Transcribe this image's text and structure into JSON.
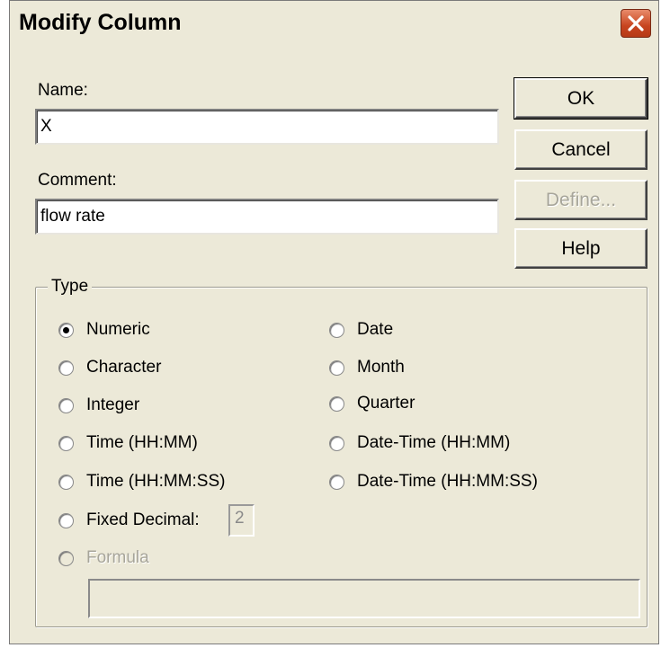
{
  "window": {
    "title": "Modify Column"
  },
  "fields": {
    "name_label": "Name:",
    "name_value": "X",
    "comment_label": "Comment:",
    "comment_value": "flow rate"
  },
  "buttons": {
    "ok": "OK",
    "cancel": "Cancel",
    "define": "Define...",
    "help": "Help"
  },
  "type_group": {
    "label": "Type",
    "selected": "Numeric",
    "left_options": [
      "Numeric",
      "Character",
      "Integer",
      "Time (HH:MM)",
      "Time (HH:MM:SS)",
      "Fixed Decimal:"
    ],
    "right_options": [
      "Date",
      "Month",
      "Quarter",
      "Date-Time (HH:MM)",
      "Date-Time (HH:MM:SS)"
    ],
    "fixed_decimal_value": "2",
    "formula_label": "Formula",
    "formula_value": ""
  },
  "colors": {
    "dialog_bg": "#ece9d8",
    "close_button": "#c7441f",
    "disabled_text": "#a7a59a"
  },
  "icons": {
    "close": "close-icon"
  }
}
